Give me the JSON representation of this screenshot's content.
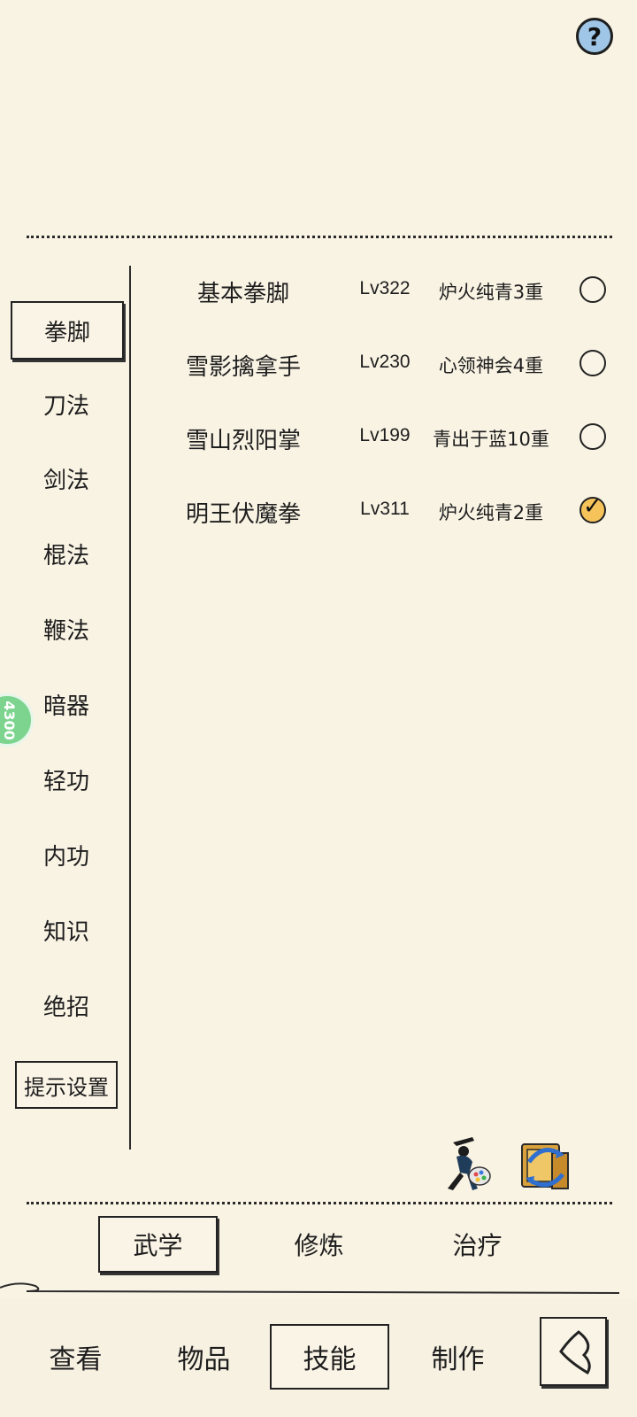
{
  "help": {
    "label": "?"
  },
  "categories": [
    {
      "label": "拳脚",
      "active": true
    },
    {
      "label": "刀法",
      "active": false
    },
    {
      "label": "剑法",
      "active": false
    },
    {
      "label": "棍法",
      "active": false
    },
    {
      "label": "鞭法",
      "active": false
    },
    {
      "label": "暗器",
      "active": false
    },
    {
      "label": "轻功",
      "active": false
    },
    {
      "label": "内功",
      "active": false
    },
    {
      "label": "知识",
      "active": false
    },
    {
      "label": "绝招",
      "active": false
    }
  ],
  "hint_settings": "提示设置",
  "float_badge": {
    "text": "4300"
  },
  "skills": [
    {
      "name": "基本拳脚",
      "level": "Lv322",
      "rank": "炉火纯青3重",
      "selected": false
    },
    {
      "name": "雪影擒拿手",
      "level": "Lv230",
      "rank": "心领神会4重",
      "selected": false
    },
    {
      "name": "雪山烈阳掌",
      "level": "Lv199",
      "rank": "青出于蓝10重",
      "selected": false
    },
    {
      "name": "明王伏魔拳",
      "level": "Lv311",
      "rank": "炉火纯青2重",
      "selected": true
    }
  ],
  "tabs": [
    {
      "label": "武学",
      "active": true
    },
    {
      "label": "修炼",
      "active": false
    },
    {
      "label": "治疗",
      "active": false
    }
  ],
  "nav": [
    {
      "label": "查看",
      "active": false
    },
    {
      "label": "物品",
      "active": false
    },
    {
      "label": "技能",
      "active": true
    },
    {
      "label": "制作",
      "active": false
    }
  ],
  "icons": {
    "action1": "warrior-palette-icon",
    "action2": "book-swap-icon",
    "back": "back-arrow-icon"
  }
}
